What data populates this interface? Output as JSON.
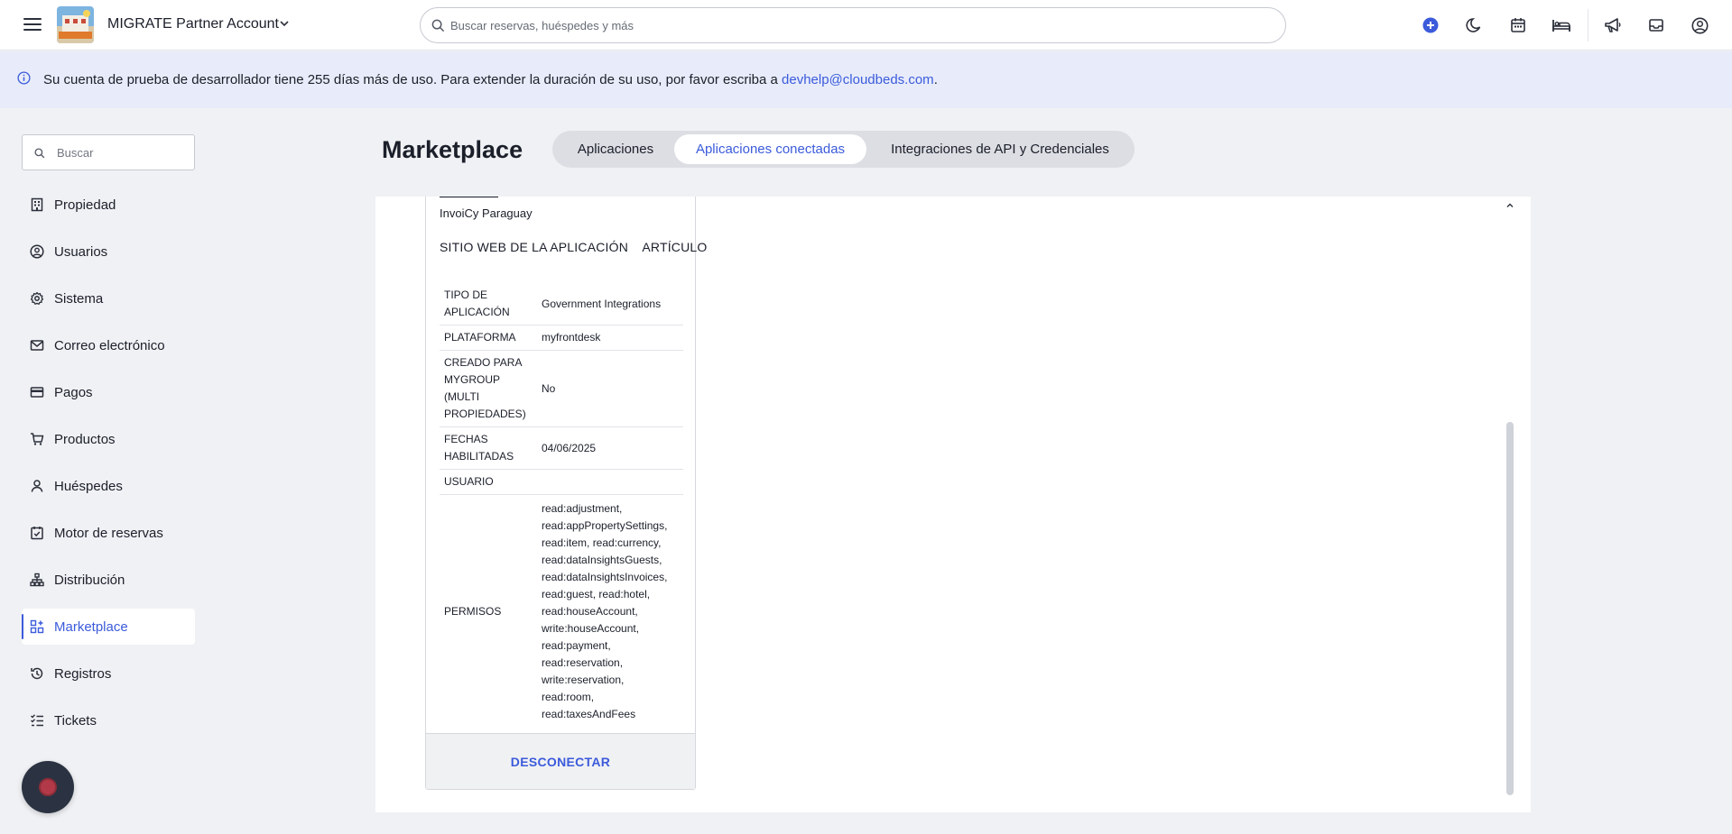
{
  "topbar": {
    "account_name": "MIGRATE Partner Account",
    "search_placeholder": "Buscar reservas, huéspedes y más",
    "icons": [
      "plus-circle-icon",
      "moon-icon",
      "calendar-icon",
      "bed-icon",
      "megaphone-icon",
      "inbox-icon",
      "user-circle-icon"
    ],
    "accent_color": "#3b5bdb"
  },
  "banner": {
    "text": "Su cuenta de prueba de desarrollador tiene 255 días más de uso. Para extender la duración de su uso, por favor escriba a ",
    "email": "devhelp@cloudbeds.com",
    "suffix": "."
  },
  "sidebar": {
    "search_placeholder": "Buscar",
    "items": [
      {
        "label": "Propiedad",
        "icon": "building-icon"
      },
      {
        "label": "Usuarios",
        "icon": "user-circle-icon"
      },
      {
        "label": "Sistema",
        "icon": "gear-icon"
      },
      {
        "label": "Correo electrónico",
        "icon": "envelope-icon"
      },
      {
        "label": "Pagos",
        "icon": "credit-card-icon"
      },
      {
        "label": "Productos",
        "icon": "cart-icon"
      },
      {
        "label": "Huéspedes",
        "icon": "person-icon"
      },
      {
        "label": "Motor de reservas",
        "icon": "calendar-check-icon"
      },
      {
        "label": "Distribución",
        "icon": "sitemap-icon"
      },
      {
        "label": "Marketplace",
        "icon": "apps-plus-icon",
        "active": true
      },
      {
        "label": "Registros",
        "icon": "history-icon"
      },
      {
        "label": "Tickets",
        "icon": "checklist-icon"
      }
    ]
  },
  "main": {
    "title": "Marketplace",
    "tabs": [
      {
        "label": "Aplicaciones"
      },
      {
        "label": "Aplicaciones conectadas",
        "active": true
      },
      {
        "label": "Integraciones de API y Credenciales"
      }
    ],
    "app": {
      "name": "InvoiCy Paraguay",
      "links": [
        "SITIO WEB DE LA APLICACIÓN",
        "ARTÍCULO"
      ],
      "details": [
        {
          "key": "TIPO DE APLICACIÓN",
          "value": "Government Integrations"
        },
        {
          "key": "PLATAFORMA",
          "value": "myfrontdesk"
        },
        {
          "key": "CREADO PARA MYGROUP (MULTI PROPIEDADES)",
          "value": "No"
        },
        {
          "key": "FECHAS HABILITADAS",
          "value": "04/06/2025"
        },
        {
          "key": "USUARIO",
          "value": ""
        },
        {
          "key": "PERMISOS",
          "value": "read:adjustment, read:appPropertySettings, read:item, read:currency, read:dataInsightsGuests, read:dataInsightsInvoices, read:guest, read:hotel, read:houseAccount, write:houseAccount, read:payment, read:reservation, write:reservation, read:room, read:taxesAndFees"
        }
      ],
      "disconnect_label": "DESCONECTAR"
    }
  }
}
